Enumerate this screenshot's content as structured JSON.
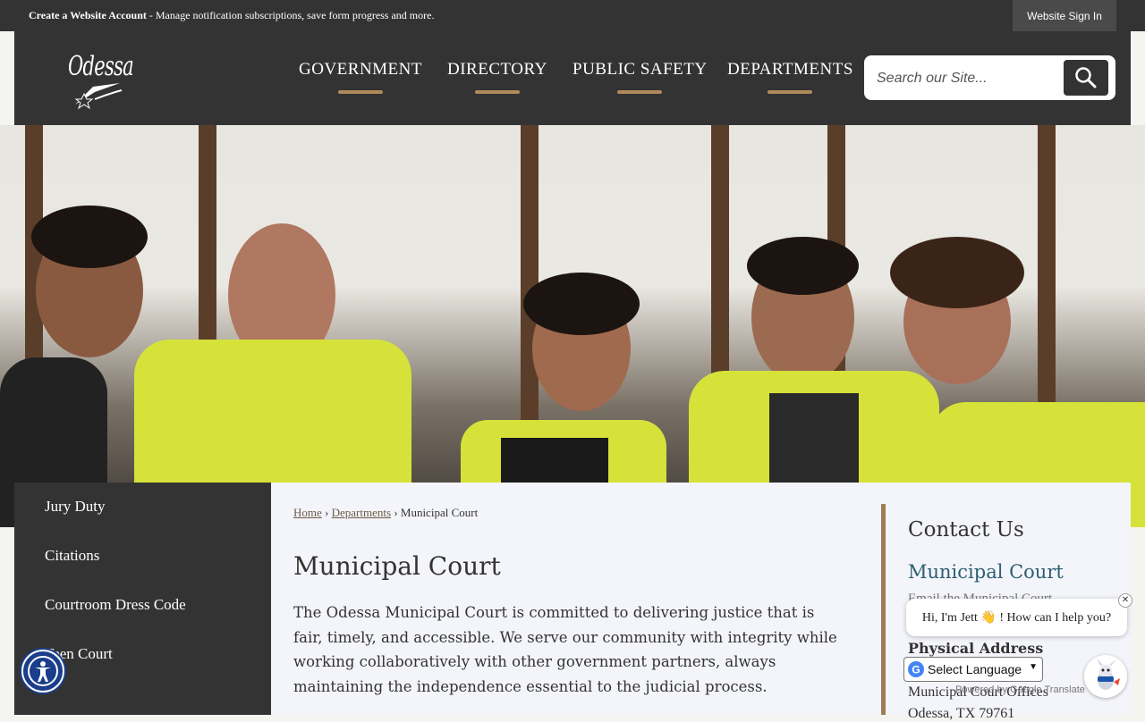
{
  "topbar": {
    "account_link": "Create a Website Account",
    "account_desc": " - Manage notification subscriptions, save form progress and more.",
    "signin_label": "Website Sign In"
  },
  "header": {
    "logo_text": "Odessa",
    "nav": [
      "GOVERNMENT",
      "DIRECTORY",
      "PUBLIC SAFETY",
      "DEPARTMENTS"
    ],
    "search_placeholder": "Search our Site..."
  },
  "sidebar": {
    "items": [
      "Jury Duty",
      "Citations",
      "Courtroom Dress Code",
      "Teen Court"
    ]
  },
  "breadcrumb": {
    "home": "Home",
    "departments": "Departments",
    "current": "Municipal Court",
    "sep": "›"
  },
  "main": {
    "title": "Municipal Court",
    "description": "The Odessa Municipal Court is committed to delivering justice that is fair, timely, and accessible. We serve our community with integrity while working collaboratively with other government partners, always maintaining the independence essential to the judicial process."
  },
  "contact": {
    "heading": "Contact Us",
    "dept_link": "Municipal Court",
    "email_link": "Email the Municipal Court",
    "physical_heading": "Physical Address",
    "address_line1": "Municipal Court Offices",
    "address_line2": "Odessa, TX 79761"
  },
  "widgets": {
    "chat_greeting": "Hi, I'm Jett 👋 ! How can I help you?",
    "chat_close": "✕",
    "language_label": "Select Language",
    "powered_by": "Powered by Google Translate"
  },
  "colors": {
    "dark": "#333333",
    "accent_bar": "#b08a5a",
    "link_teal": "#2c5f73",
    "vest": "#d6e23a"
  }
}
